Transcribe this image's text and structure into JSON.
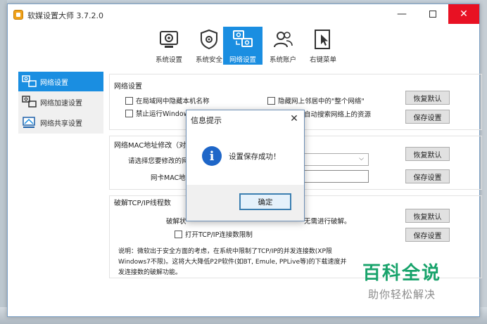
{
  "app": {
    "title": "软媒设置大师 3.7.2.0"
  },
  "toolbar": {
    "items": [
      {
        "label": "系统设置",
        "icon": "gear-chip-icon"
      },
      {
        "label": "系统安全",
        "icon": "shield-gear-icon"
      },
      {
        "label": "网络设置",
        "icon": "network-computers-icon",
        "active": true
      },
      {
        "label": "系统账户",
        "icon": "users-icon"
      },
      {
        "label": "右键菜单",
        "icon": "cursor-menu-icon"
      }
    ]
  },
  "sidebar": {
    "items": [
      {
        "label": "网络设置",
        "active": true
      },
      {
        "label": "网络加速设置"
      },
      {
        "label": "网络共享设置"
      }
    ]
  },
  "network": {
    "group_label": "网络设置",
    "cb_hide_name": "在局域网中隐藏本机名称",
    "cb_hide_entire": "隐藏网上邻居中的\"整个网络\"",
    "cb_disable_windows": "禁止运行Window",
    "cb_auto_search": "自动搜索网络上的资源",
    "restore_label": "恢复默认",
    "save_label": "保存设置"
  },
  "mac": {
    "group_label": "网络MAC地址修改（对无",
    "select_label": "请选择您要修改的网",
    "mac_label": "网卡MAC地",
    "restore_label": "恢复默认",
    "save_label": "保存设置"
  },
  "tcp": {
    "group_label": "破解TCP/IP线程数",
    "crack_label_left": "破解状",
    "crack_label_right": "无需进行破解。",
    "cb_enable_limit": "打开TCP/IP连接数限制",
    "note": "说明：微软出于安全方面的考虑，在系统中限制了TCP/IP的并发连接数(XP限Windows7不限)。这将大大降低P2P软件(如BT, Emule, PPLive等)的下载速度并发连接数的破解功能。",
    "restore_label": "恢复默认",
    "save_label": "保存设置"
  },
  "dialog": {
    "title": "信息提示",
    "message": "设置保存成功！",
    "ok_label": "确定",
    "icon": "info-icon"
  },
  "watermark": {
    "title": "百科全说",
    "subtitle": "助你轻松解决"
  },
  "colors": {
    "accent": "#1a8ee1",
    "close": "#e81123",
    "watermark": "#18a36b"
  }
}
